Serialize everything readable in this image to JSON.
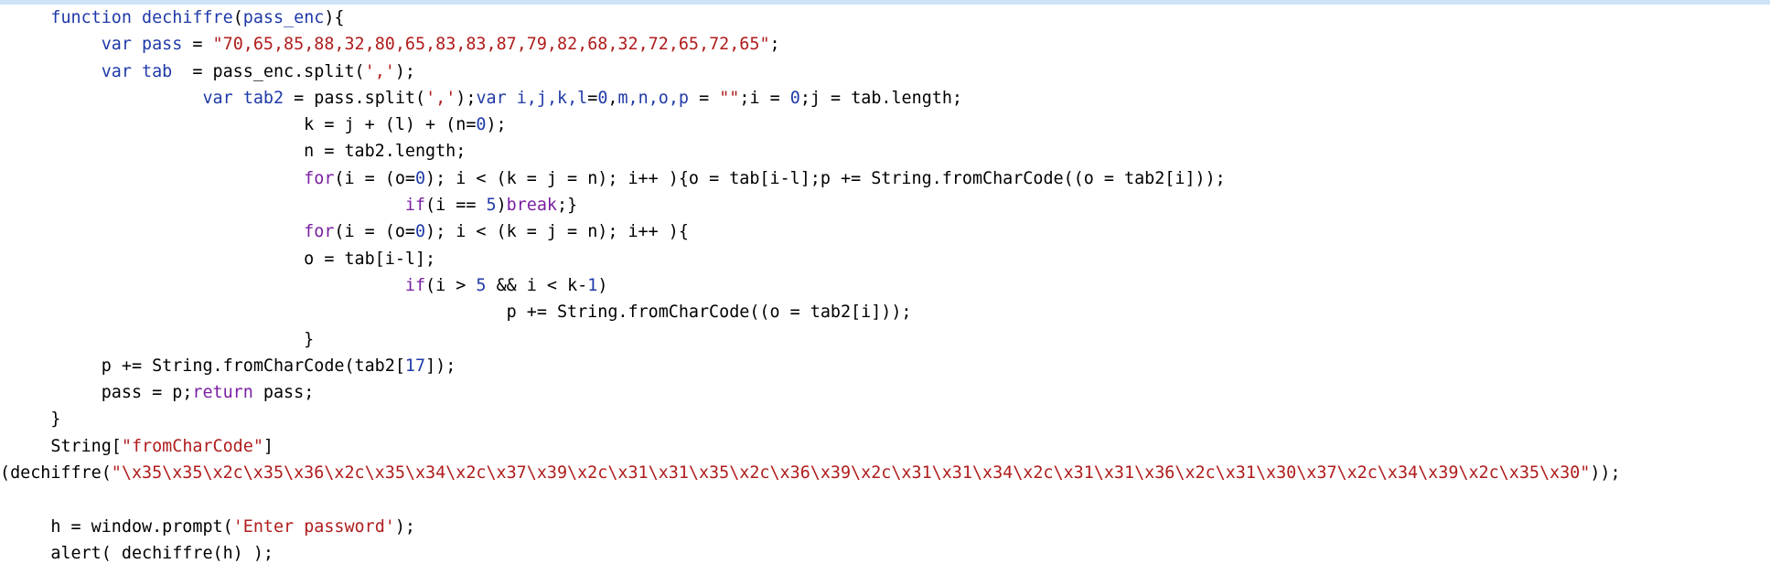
{
  "editor": {
    "lines": [
      {
        "indent": "     ",
        "parts": [
          [
            "kwb",
            "function"
          ],
          [
            "plain",
            " "
          ],
          [
            "fn",
            "dechiffre"
          ],
          [
            "plain",
            "("
          ],
          [
            "var",
            "pass_enc"
          ],
          [
            "plain",
            "){"
          ]
        ]
      },
      {
        "indent": "          ",
        "parts": [
          [
            "kwb",
            "var"
          ],
          [
            "plain",
            " "
          ],
          [
            "var",
            "pass"
          ],
          [
            "plain",
            " = "
          ],
          [
            "str",
            "\"70,65,85,88,32,80,65,83,83,87,79,82,68,32,72,65,72,65\""
          ],
          [
            "plain",
            ";"
          ]
        ]
      },
      {
        "indent": "          ",
        "parts": [
          [
            "kwb",
            "var"
          ],
          [
            "plain",
            " "
          ],
          [
            "var",
            "tab"
          ],
          [
            "plain",
            "  = pass_enc.split("
          ],
          [
            "str",
            "','"
          ],
          [
            "plain",
            ");"
          ]
        ]
      },
      {
        "indent": "                    ",
        "parts": [
          [
            "kwb",
            "var"
          ],
          [
            "plain",
            " "
          ],
          [
            "var",
            "tab2"
          ],
          [
            "plain",
            " = pass.split("
          ],
          [
            "str",
            "','"
          ],
          [
            "plain",
            ");"
          ],
          [
            "kwb",
            "var"
          ],
          [
            "plain",
            " "
          ],
          [
            "var",
            "i,j,k,l"
          ],
          [
            "plain",
            "="
          ],
          [
            "num",
            "0"
          ],
          [
            "plain",
            ","
          ],
          [
            "var",
            "m,n,o,p"
          ],
          [
            "plain",
            " = "
          ],
          [
            "str",
            "\"\""
          ],
          [
            "plain",
            ";i = "
          ],
          [
            "num",
            "0"
          ],
          [
            "plain",
            ";j = tab.length;"
          ]
        ]
      },
      {
        "indent": "                              ",
        "parts": [
          [
            "plain",
            "k = j + (l) + (n="
          ],
          [
            "num",
            "0"
          ],
          [
            "plain",
            ");"
          ]
        ]
      },
      {
        "indent": "                              ",
        "parts": [
          [
            "plain",
            "n = tab2.length;"
          ]
        ]
      },
      {
        "indent": "                              ",
        "parts": [
          [
            "kw",
            "for"
          ],
          [
            "plain",
            "(i = (o="
          ],
          [
            "num",
            "0"
          ],
          [
            "plain",
            "); i < (k = j = n); i++ ){o = tab[i-l];p += String.fromCharCode((o = tab2[i]));"
          ]
        ]
      },
      {
        "indent": "                                        ",
        "parts": [
          [
            "kw",
            "if"
          ],
          [
            "plain",
            "(i == "
          ],
          [
            "num",
            "5"
          ],
          [
            "plain",
            ")"
          ],
          [
            "kw",
            "break"
          ],
          [
            "plain",
            ";}"
          ]
        ]
      },
      {
        "indent": "                              ",
        "parts": [
          [
            "kw",
            "for"
          ],
          [
            "plain",
            "(i = (o="
          ],
          [
            "num",
            "0"
          ],
          [
            "plain",
            "); i < (k = j = n); i++ ){"
          ]
        ]
      },
      {
        "indent": "                              ",
        "parts": [
          [
            "plain",
            "o = tab[i-l];"
          ]
        ]
      },
      {
        "indent": "                                        ",
        "parts": [
          [
            "kw",
            "if"
          ],
          [
            "plain",
            "(i > "
          ],
          [
            "num",
            "5"
          ],
          [
            "plain",
            " && i < k-"
          ],
          [
            "num",
            "1"
          ],
          [
            "plain",
            ")"
          ]
        ]
      },
      {
        "indent": "                                                  ",
        "parts": [
          [
            "plain",
            "p += String.fromCharCode((o = tab2[i]));"
          ]
        ]
      },
      {
        "indent": "                              ",
        "parts": [
          [
            "plain",
            "}"
          ]
        ]
      },
      {
        "indent": "          ",
        "parts": [
          [
            "plain",
            "p += String.fromCharCode(tab2["
          ],
          [
            "num",
            "17"
          ],
          [
            "plain",
            "]);"
          ]
        ]
      },
      {
        "indent": "          ",
        "parts": [
          [
            "plain",
            "pass = p;"
          ],
          [
            "kw",
            "return"
          ],
          [
            "plain",
            " pass;"
          ]
        ]
      },
      {
        "indent": "     ",
        "parts": [
          [
            "plain",
            "}"
          ]
        ]
      },
      {
        "indent": "     ",
        "parts": [
          [
            "plain",
            "String["
          ],
          [
            "str",
            "\"fromCharCode\""
          ],
          [
            "plain",
            "]"
          ]
        ]
      },
      {
        "indent": "",
        "parts": [
          [
            "plain",
            "(dechiffre("
          ],
          [
            "str",
            "\"\\x35\\x35\\x2c\\x35\\x36\\x2c\\x35\\x34\\x2c\\x37\\x39\\x2c\\x31\\x31\\x35\\x2c\\x36\\x39\\x2c\\x31\\x31\\x34\\x2c\\x31\\x31\\x36\\x2c\\x31\\x30\\x37\\x2c\\x34\\x39\\x2c\\x35\\x30\""
          ],
          [
            "plain",
            "));"
          ]
        ]
      },
      {
        "indent": "",
        "parts": []
      },
      {
        "indent": "     ",
        "parts": [
          [
            "plain",
            "h = window.prompt("
          ],
          [
            "str",
            "'Enter password'"
          ],
          [
            "plain",
            ");"
          ]
        ]
      },
      {
        "indent": "     ",
        "parts": [
          [
            "plain",
            "alert( dechiffre(h) );"
          ]
        ]
      }
    ]
  }
}
